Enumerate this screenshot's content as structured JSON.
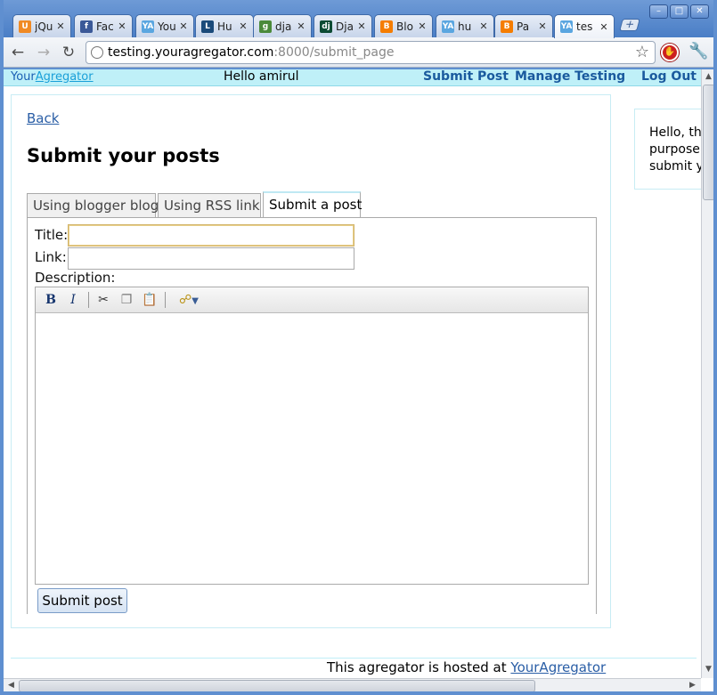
{
  "browser": {
    "tabs": [
      {
        "title": "jQu",
        "icon": "ubuntu-icon",
        "color": "#f08a24",
        "glyph": "U"
      },
      {
        "title": "Fac",
        "icon": "facebook-icon",
        "color": "#3b5998",
        "glyph": "f"
      },
      {
        "title": "You",
        "icon": "youragregator-icon",
        "color": "#5aa6e0",
        "glyph": "YA"
      },
      {
        "title": "Hu",
        "icon": "boot-icon",
        "color": "#1a4a7a",
        "glyph": "L"
      },
      {
        "title": "dja",
        "icon": "google-icon",
        "color": "#4a8a3a",
        "glyph": "g"
      },
      {
        "title": "Dja",
        "icon": "django-icon",
        "color": "#0c4b33",
        "glyph": "dj"
      },
      {
        "title": "Blo",
        "icon": "blogger-icon",
        "color": "#f57d00",
        "glyph": "B"
      },
      {
        "title": "hu",
        "icon": "youragregator-icon",
        "color": "#5aa6e0",
        "glyph": "YA"
      },
      {
        "title": "Pa",
        "icon": "blogger-icon",
        "color": "#f57d00",
        "glyph": "B"
      },
      {
        "title": "tes",
        "icon": "youragregator-icon",
        "color": "#5aa6e0",
        "glyph": "YA"
      }
    ],
    "new_tab": "+",
    "url_host": "testing.youragregator.com",
    "url_rest": ":8000/submit_page"
  },
  "site": {
    "brand_part1": "Your",
    "brand_part2": "Agregator",
    "greeting": "Hello amirul",
    "nav": {
      "submit_post": "Submit Post",
      "manage_testing": "Manage Testing",
      "log_out": "Log Out"
    }
  },
  "main": {
    "back": "Back",
    "heading": "Submit your posts",
    "tabs": [
      "Using blogger blog",
      "Using RSS link",
      "Submit a post"
    ],
    "form": {
      "title_label": "Title:",
      "title_value": "",
      "link_label": "Link:",
      "link_value": "",
      "description_label": "Description:",
      "submit_label": "Submit post"
    }
  },
  "sidebar": {
    "line1": "Hello, thi",
    "line2": "purpose",
    "line3": "submit y"
  },
  "footer": {
    "text": "This agregator is hosted at ",
    "link": "YourAgregator"
  }
}
